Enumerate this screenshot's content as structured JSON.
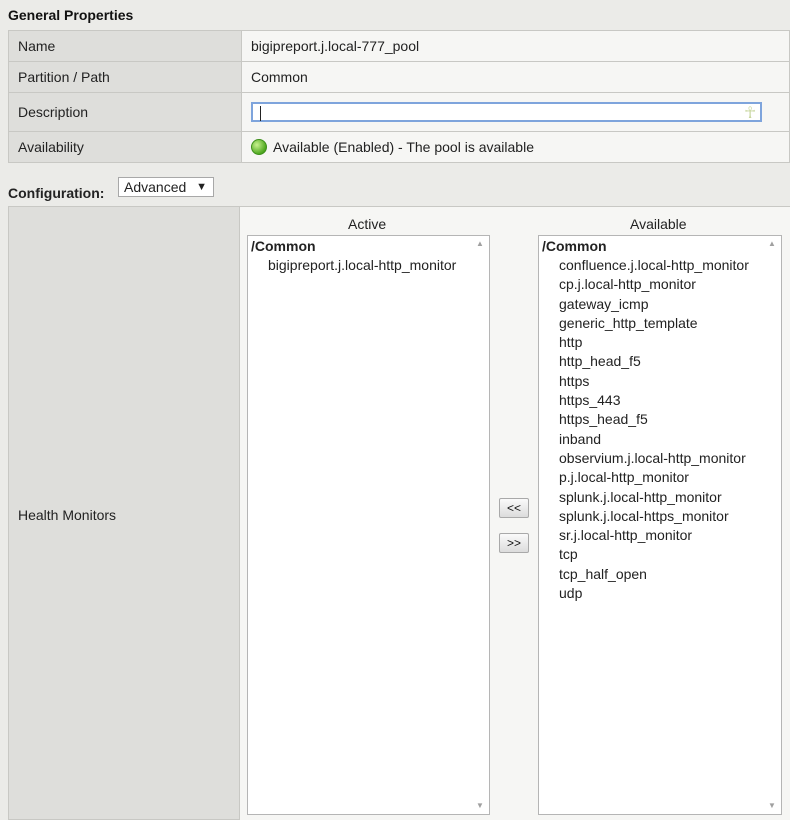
{
  "general": {
    "title": "General Properties",
    "rows": {
      "name": {
        "label": "Name",
        "value": "bigipreport.j.local-777_pool"
      },
      "partition": {
        "label": "Partition / Path",
        "value": "Common"
      },
      "description": {
        "label": "Description",
        "value": ""
      },
      "availability": {
        "label": "Availability",
        "value": "Available (Enabled) - The pool is available",
        "status_color": "#4fa820"
      }
    }
  },
  "configuration": {
    "label": "Configuration:",
    "selected": "Advanced"
  },
  "health_monitors": {
    "label": "Health Monitors",
    "active": {
      "header": "Active",
      "group": "/Common",
      "items": [
        "bigipreport.j.local-http_monitor"
      ]
    },
    "available": {
      "header": "Available",
      "group": "/Common",
      "items": [
        "confluence.j.local-http_monitor",
        "cp.j.local-http_monitor",
        "gateway_icmp",
        "generic_http_template",
        "http",
        "http_head_f5",
        "https",
        "https_443",
        "https_head_f5",
        "inband",
        "observium.j.local-http_monitor",
        "p.j.local-http_monitor",
        "splunk.j.local-http_monitor",
        "splunk.j.local-https_monitor",
        "sr.j.local-http_monitor",
        "tcp",
        "tcp_half_open",
        "udp"
      ]
    },
    "buttons": {
      "add": "<<",
      "remove": ">>"
    }
  }
}
